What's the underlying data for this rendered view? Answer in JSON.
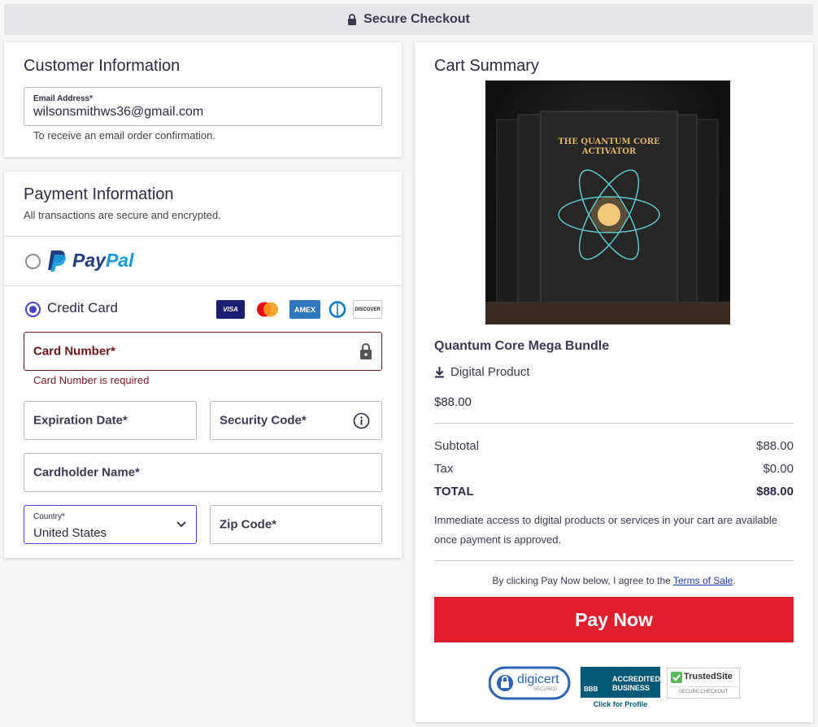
{
  "header": {
    "title": "Secure Checkout"
  },
  "customer": {
    "heading": "Customer Information",
    "email": {
      "label": "Email Address*",
      "value": "wilsonsmithws36@gmail.com",
      "hint": "To receive an email order confirmation."
    }
  },
  "payment": {
    "heading": "Payment Information",
    "subheading": "All transactions are secure and encrypted.",
    "paypal_label": "PayPal",
    "paypal_pay": "Pay",
    "paypal_pal": "Pal",
    "credit_card_label": "Credit Card",
    "card_brands": [
      "VISA",
      "Mastercard",
      "AMEX",
      "Diners",
      "DISCOVER"
    ],
    "card_number": {
      "placeholder": "Card Number*",
      "error": "Card Number is required"
    },
    "expiration": {
      "placeholder": "Expiration Date*"
    },
    "security_code": {
      "placeholder": "Security Code*"
    },
    "cardholder": {
      "placeholder": "Cardholder Name*"
    },
    "country": {
      "label": "Country*",
      "value": "United States"
    },
    "zip": {
      "placeholder": "Zip Code*"
    }
  },
  "cart": {
    "heading": "Cart Summary",
    "product_image_text": "THE QUANTUM CORE ACTIVATOR",
    "product_name": "Quantum Core Mega Bundle",
    "product_type": "Digital Product",
    "product_price": "$88.00",
    "subtotal_label": "Subtotal",
    "subtotal_value": "$88.00",
    "tax_label": "Tax",
    "tax_value": "$0.00",
    "total_label": "TOTAL",
    "total_value": "$88.00",
    "notice": "Immediate access to digital products or services in your cart are available once payment is approved.",
    "agree_prefix": "By clicking Pay Now below, I agree to the",
    "terms_link": "Terms of Sale",
    "agree_suffix": ".",
    "pay_button": "Pay Now"
  },
  "trust": {
    "digicert": "digicert",
    "digicert_sub": "SECURED",
    "bbb_line1": "ACCREDITED",
    "bbb_line2": "BUSINESS",
    "bbb_mark": "BBB",
    "bbb_link": "Click for Profile",
    "trustedsite": "TrustedSite",
    "trustedsite_sub": "SECURE CHECKOUT"
  },
  "colors": {
    "accent": "#4845c9",
    "pay_button": "#e01f2c",
    "error": "#7a1b22",
    "paypal_dark": "#253b80",
    "paypal_light": "#179bd7"
  }
}
